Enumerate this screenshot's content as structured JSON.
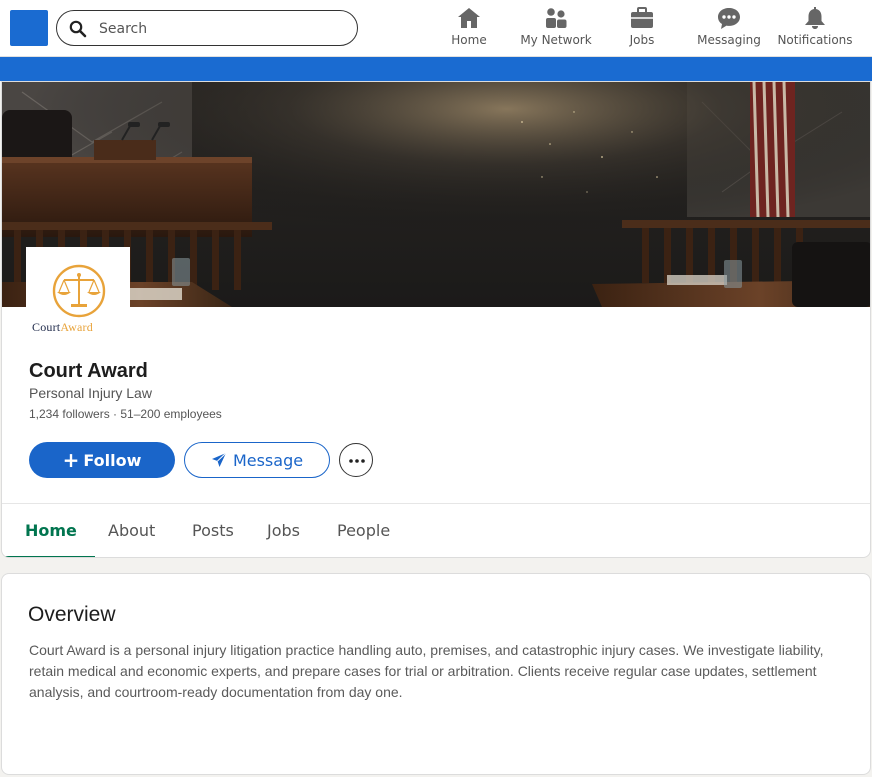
{
  "nav": {
    "search_placeholder": "Search",
    "items": [
      {
        "label": "Home",
        "icon": "home-icon"
      },
      {
        "label": "My Network",
        "icon": "people-icon"
      },
      {
        "label": "Jobs",
        "icon": "briefcase-icon"
      },
      {
        "label": "Messaging",
        "icon": "chat-icon"
      },
      {
        "label": "Notifications",
        "icon": "bell-icon"
      }
    ]
  },
  "colors": {
    "brand_blue": "#1a6bd1",
    "accent_green": "#01754f",
    "logo_gold": "#e8a33a",
    "logo_navy": "#1f2a4a"
  },
  "company": {
    "logo_text_first": "Court",
    "logo_text_second": "Award",
    "name": "Court Award",
    "tagline": "Personal Injury Law",
    "meta": "1,234 followers · 51–200 employees"
  },
  "actions": {
    "follow_label": "Follow",
    "message_label": "Message"
  },
  "tabs": [
    {
      "label": "Home",
      "active": true
    },
    {
      "label": "About",
      "active": false
    },
    {
      "label": "Posts",
      "active": false
    },
    {
      "label": "Jobs",
      "active": false
    },
    {
      "label": "People",
      "active": false
    }
  ],
  "overview": {
    "title": "Overview",
    "text": "Court Award is a personal injury litigation practice handling auto, premises, and catastrophic injury cases. We investigate liability, retain medical and economic experts, and prepare cases for trial or arbitration. Clients receive regular case updates, settlement analysis, and courtroom-ready documentation from day one."
  }
}
